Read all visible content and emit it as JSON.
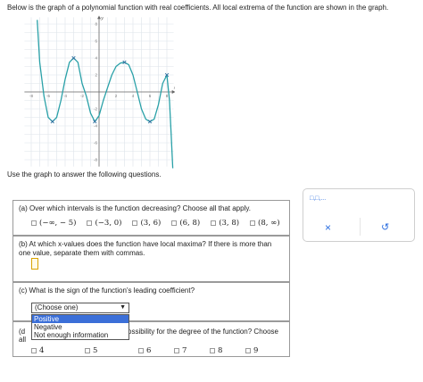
{
  "intro": "Below is the graph of a polynomial function with real coefficients. All local extrema of the function are shown in the graph.",
  "prompt": "Use the graph to answer the following questions.",
  "graph": {
    "x_ticks": [
      "-8",
      "-6",
      "-4",
      "-2",
      "2",
      "4",
      "6",
      "8"
    ],
    "y_ticks": [
      "8",
      "6",
      "4",
      "2",
      "-2",
      "-4",
      "-6",
      "-8"
    ],
    "x_axis_label": "x",
    "y_axis_label": "y",
    "curve_color": "#2aa1a8",
    "curve_points": [
      [
        -7.3,
        8.5
      ],
      [
        -7.0,
        3.5
      ],
      [
        -6.5,
        -0.5
      ],
      [
        -6.0,
        -3.0
      ],
      [
        -5.5,
        -3.5
      ],
      [
        -5.0,
        -3.0
      ],
      [
        -4.5,
        -1.0
      ],
      [
        -4.0,
        1.5
      ],
      [
        -3.5,
        3.5
      ],
      [
        -3.0,
        4.0
      ],
      [
        -2.5,
        3.5
      ],
      [
        -2.0,
        1.0
      ],
      [
        -1.5,
        -0.5
      ],
      [
        -1.0,
        -2.5
      ],
      [
        -0.5,
        -3.5
      ],
      [
        0.0,
        -2.8
      ],
      [
        0.5,
        -1.0
      ],
      [
        1.0,
        0.5
      ],
      [
        1.5,
        2.0
      ],
      [
        2.0,
        3.0
      ],
      [
        2.5,
        3.4
      ],
      [
        3.0,
        3.5
      ],
      [
        3.5,
        3.2
      ],
      [
        4.0,
        2.0
      ],
      [
        4.5,
        0.0
      ],
      [
        5.0,
        -2.0
      ],
      [
        5.5,
        -3.2
      ],
      [
        6.0,
        -3.5
      ],
      [
        6.5,
        -3.2
      ],
      [
        7.0,
        -1.5
      ],
      [
        7.5,
        1.0
      ],
      [
        8.0,
        2.0
      ],
      [
        8.3,
        -1.0
      ],
      [
        8.5,
        -5.0
      ],
      [
        8.7,
        -9.0
      ]
    ],
    "extrema": [
      [
        -5.5,
        -3.5
      ],
      [
        -3.0,
        4.0
      ],
      [
        -0.5,
        -3.5
      ],
      [
        3.0,
        3.5
      ],
      [
        6.0,
        -3.5
      ],
      [
        8.0,
        2.0
      ]
    ]
  },
  "qa": {
    "text": "(a) Over which intervals is the function decreasing? Choose all that apply.",
    "options": [
      "(−∞, − 5)",
      "(−3, 0)",
      "(3, 6)",
      "(6, 8)",
      "(3, 8)",
      "(8, ∞)"
    ]
  },
  "qb": {
    "text": "(b) At which x-values does the function have local maxima? If there is more than one value, separate them with commas."
  },
  "qc": {
    "text": "(c) What is the sign of the function's leading coefficient?",
    "select_value": "(Choose one)",
    "dropdown_options": [
      "Positive",
      "Negative",
      "Not enough information"
    ]
  },
  "qd": {
    "label_start": "(d",
    "text_right": "ossibility for the degree of the function? Choose",
    "text_line2": "all",
    "options": [
      "4",
      "5",
      "6",
      "7",
      "8",
      "9"
    ]
  },
  "tool": {
    "tab_label": "□,□,...",
    "clear_symbol": "×",
    "reset_symbol": "↺"
  }
}
